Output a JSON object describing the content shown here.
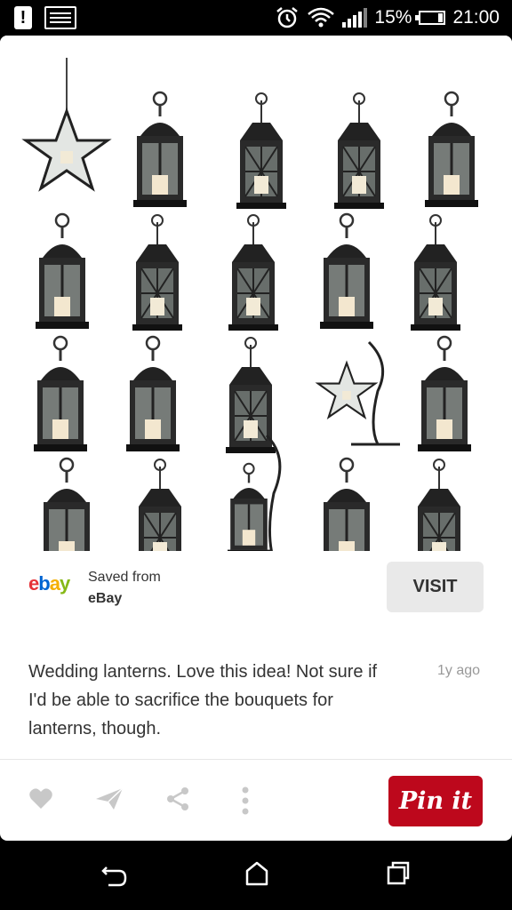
{
  "status_bar": {
    "battery": "15%",
    "time": "21:00"
  },
  "pin_image": {
    "alt": "Assortment of black metal lanterns"
  },
  "source": {
    "logo": {
      "e": "e",
      "b": "b",
      "a": "a",
      "y": "y"
    },
    "saved_from": "Saved from",
    "name": "eBay",
    "visit_label": "VISIT"
  },
  "pin": {
    "description": "Wedding lanterns. Love this idea! Not sure if I'd be able to sacrifice the bouquets for lanterns, though.",
    "timestamp": "1y ago"
  },
  "actions": {
    "pin_it_label": "Pin it"
  },
  "icons": [
    "alert-icon",
    "gallery-icon",
    "alarm-icon",
    "wifi-icon",
    "signal-icon",
    "battery-icon",
    "heart-icon",
    "send-icon",
    "share-icon",
    "more-icon",
    "back-icon",
    "home-icon",
    "recents-icon"
  ]
}
